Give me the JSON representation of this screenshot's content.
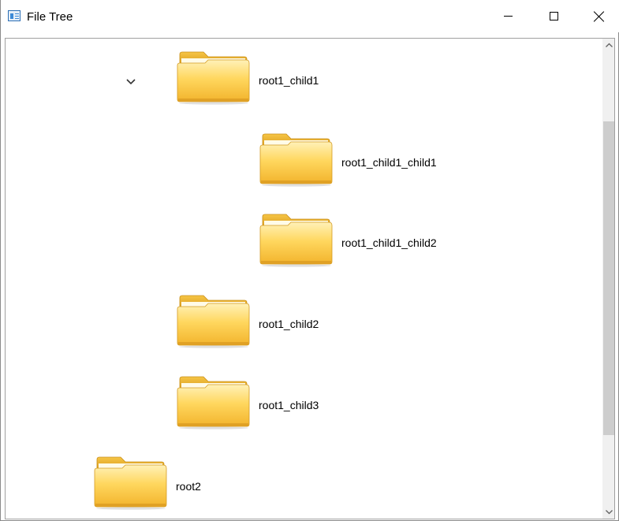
{
  "window": {
    "title": "File Tree"
  },
  "tree": {
    "items": [
      {
        "label": "root1_child1",
        "expanded": true,
        "depth": 1
      },
      {
        "label": "root1_child1_child1",
        "depth": 2
      },
      {
        "label": "root1_child1_child2",
        "depth": 2
      },
      {
        "label": "root1_child2",
        "depth": 1
      },
      {
        "label": "root1_child3",
        "depth": 1
      },
      {
        "label": "root2",
        "depth": 0
      }
    ]
  },
  "icons": {
    "folder": "folder-icon",
    "expander": "chevron-down-icon",
    "scroll_up": "chevron-up-icon",
    "scroll_down": "chevron-down-icon"
  },
  "colors": {
    "folder_back": "#E8A826",
    "folder_front": "#FFD35E",
    "scrollbar_thumb": "#CDCDCD"
  }
}
